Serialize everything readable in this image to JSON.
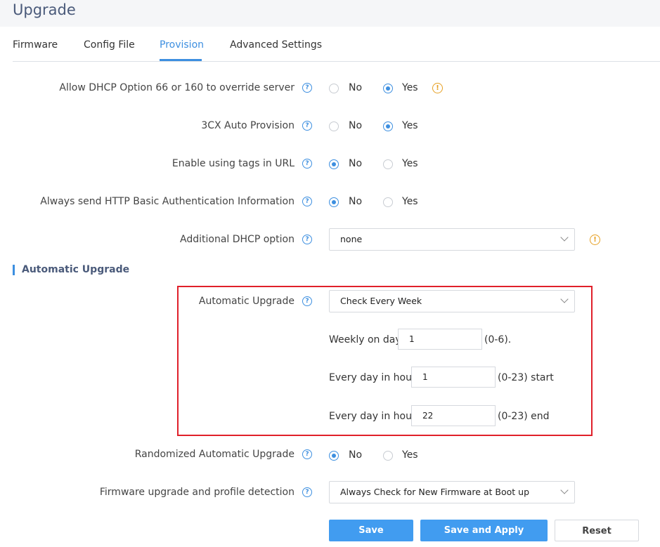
{
  "page": {
    "title": "Upgrade"
  },
  "tabs": [
    {
      "label": "Firmware",
      "active": false
    },
    {
      "label": "Config File",
      "active": false
    },
    {
      "label": "Provision",
      "active": true
    },
    {
      "label": "Advanced Settings",
      "active": false
    }
  ],
  "settings": {
    "dhcp_override": {
      "label": "Allow DHCP Option 66 or 160 to override server",
      "no": "No",
      "yes": "Yes",
      "selected": "Yes"
    },
    "cx_auto_provision": {
      "label": "3CX Auto Provision",
      "no": "No",
      "yes": "Yes",
      "selected": "Yes"
    },
    "tags_in_url": {
      "label": "Enable using tags in URL",
      "no": "No",
      "yes": "Yes",
      "selected": "No"
    },
    "http_basic_auth": {
      "label": "Always send HTTP Basic Authentication Information",
      "no": "No",
      "yes": "Yes",
      "selected": "No"
    },
    "additional_dhcp": {
      "label": "Additional DHCP option",
      "value": "none"
    }
  },
  "auto_upgrade": {
    "section_title": "Automatic Upgrade",
    "label": "Automatic Upgrade",
    "value": "Check Every Week",
    "weekly_label": "Weekly on day",
    "weekly_value": "1",
    "weekly_range": "(0-6).",
    "start_label": "Every day in hour",
    "start_value": "1",
    "start_range": "(0-23) start",
    "end_label": "Every day in hour",
    "end_value": "22",
    "end_range": "(0-23) end"
  },
  "randomized": {
    "label": "Randomized Automatic Upgrade",
    "no": "No",
    "yes": "Yes",
    "selected": "No"
  },
  "firmware_detection": {
    "label": "Firmware upgrade and profile detection",
    "value": "Always Check for New Firmware at Boot up"
  },
  "buttons": {
    "save": "Save",
    "save_apply": "Save and Apply",
    "reset": "Reset"
  },
  "colors": {
    "accent": "#3d8fe0",
    "highlight": "#e0202a",
    "warning": "#e6a023"
  },
  "icons": {
    "help": "question-circle-icon",
    "warning": "warning-circle-icon",
    "dropdown": "chevron-down-icon"
  }
}
